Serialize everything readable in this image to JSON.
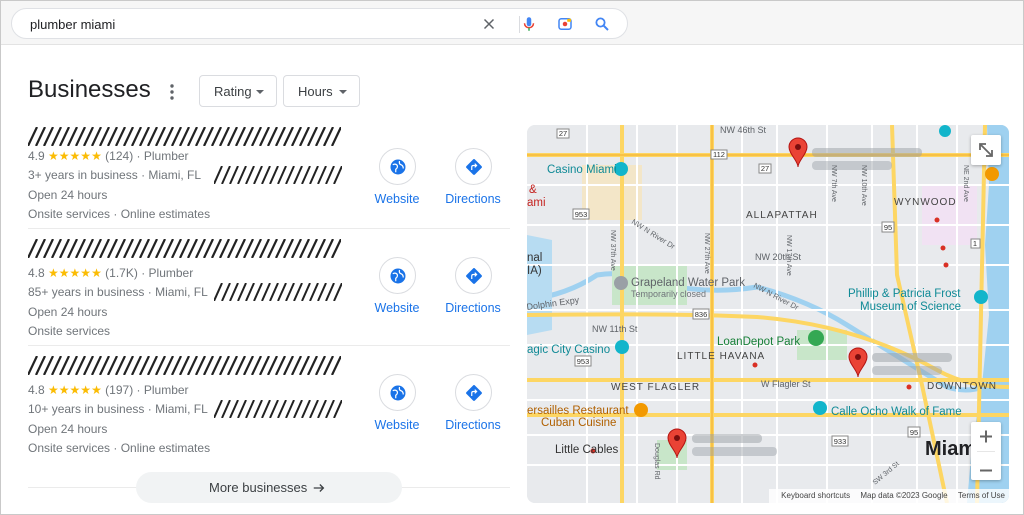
{
  "search": {
    "query": "plumber miami"
  },
  "header": {
    "title": "Businesses",
    "filters": [
      {
        "label": "Rating"
      },
      {
        "label": "Hours"
      }
    ]
  },
  "listings": [
    {
      "rating": "4.9",
      "stars": "★★★★★",
      "reviews": "(124)",
      "category": "Plumber",
      "line2": "3+ years in business · Miami, FL",
      "line3": "Open 24 hours",
      "line4": "Onsite services · Online estimates",
      "website_label": "Website",
      "directions_label": "Directions"
    },
    {
      "rating": "4.8",
      "stars": "★★★★★",
      "reviews": "(1.7K)",
      "category": "Plumber",
      "line2": "85+ years in business · Miami, FL",
      "line3": "Open 24 hours",
      "line4": "Onsite services",
      "website_label": "Website",
      "directions_label": "Directions"
    },
    {
      "rating": "4.8",
      "stars": "★★★★★",
      "reviews": "(197)",
      "category": "Plumber",
      "line2": "10+ years in business · Miami, FL",
      "line3": "Open 24 hours",
      "line4": "Onsite services · Online estimates",
      "website_label": "Website",
      "directions_label": "Directions"
    }
  ],
  "more_button": "More businesses",
  "map": {
    "labels": {
      "nw46": "NW 46th St",
      "casino": "Casino Miami",
      "allapattah": "ALLAPATTAH",
      "wynwood": "WYNWOOD",
      "nw20": "NW 20th St",
      "grapeland": "Grapeland Water Park",
      "temp_closed": "Temporarily closed",
      "phillip": "Phillip & Patricia Frost",
      "museum": "Museum of Science",
      "nw11": "NW 11th St",
      "dolphin": "Dolphin Expy",
      "magic_city": "agic City Casino",
      "loandepot": "LoanDepot Park",
      "little_havana": "LITTLE HAVANA",
      "west_flagler": "WEST FLAGLER",
      "wflagler": "W Flagler St",
      "downtown": "DOWNTOWN",
      "versailles": "ersailles Restaurant",
      "cuban": "Cuban Cuisine",
      "calle_ocho": "Calle Ocho Walk of Fame",
      "little_cables": "Little Cables",
      "miami": "Miami",
      "river_dr": "NW N River Dr",
      "nw7ave": "NW 7th Ave",
      "nw17ave": "NW 17th Ave",
      "nw10ave": "NW 10th Ave",
      "ne2ave": "NE 2nd Ave",
      "nw37ave": "NW 37th Ave",
      "nw27ave": "NW 27th Ave",
      "douglas": "Douglas Rd",
      "sw3rd": "SW 3rd St",
      "left_edge_1": "nal",
      "left_edge_2": "IA)",
      "left_edge_3": "&",
      "left_edge_4": "ami",
      "shield_27": "27",
      "shield_112": "112",
      "shield_953": "953",
      "shield_836": "836",
      "shield_95": "95",
      "shield_933": "933",
      "shield_1": "1"
    },
    "attribution": {
      "shortcuts": "Keyboard shortcuts",
      "data": "Map data ©2023 Google",
      "terms": "Terms of Use"
    }
  },
  "colors": {
    "accent": "#1a73e8",
    "star": "#fbbc04",
    "pin": "#ea4335",
    "park": "#c8e6c9",
    "water": "#9fd1f0"
  }
}
